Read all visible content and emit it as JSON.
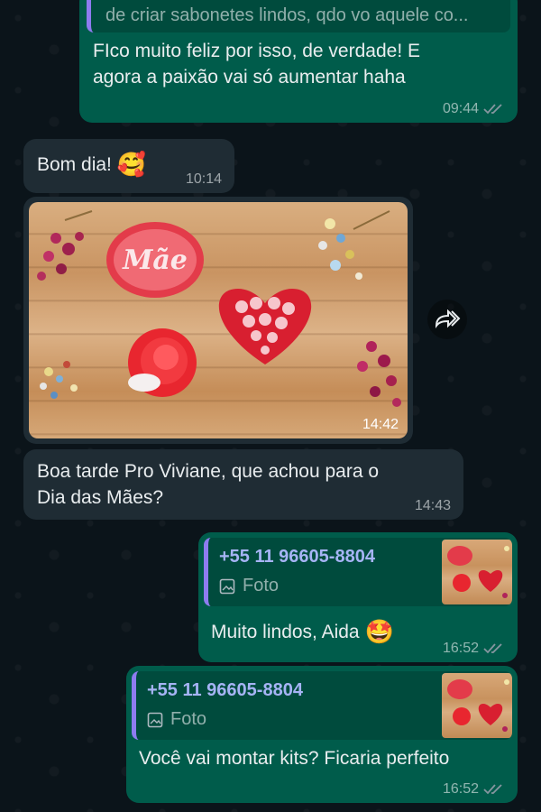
{
  "messages": {
    "m1": {
      "quote_text": "de criar sabonetes lindos, qdo vo aquele co...",
      "text_line1": "FIco muito feliz por isso, de verdade! E",
      "text_line2": "agora a paixão vai só aumentar haha",
      "time": "09:44"
    },
    "m2": {
      "text": "Bom dia!",
      "emoji": "🥰",
      "time": "10:14"
    },
    "m3": {
      "photo_label": "Mãe",
      "time": "14:42"
    },
    "m4": {
      "text_line1": "Boa tarde Pro Viviane,  que achou para o",
      "text_line2": "Dia das Mães?",
      "time": "14:43"
    },
    "m5": {
      "quote_sender": "+55 11 96605-8804",
      "quote_type": "Foto",
      "text": "Muito lindos, Aida",
      "emoji": "🤩",
      "time": "16:52"
    },
    "m6": {
      "quote_sender": "+55 11 96605-8804",
      "quote_type": "Foto",
      "text": "Você vai montar kits? Ficaria perfeito",
      "time": "16:52"
    }
  },
  "colors": {
    "background": "#0b141a",
    "outgoing_bubble": "#005c4b",
    "incoming_bubble": "#1f2c34",
    "read_ticks": "#8696a0",
    "quote_bar": "#8e7cf0"
  },
  "icons": {
    "forward": "forward-arrow-icon",
    "photo": "image-icon",
    "read_receipt": "double-check-icon"
  }
}
